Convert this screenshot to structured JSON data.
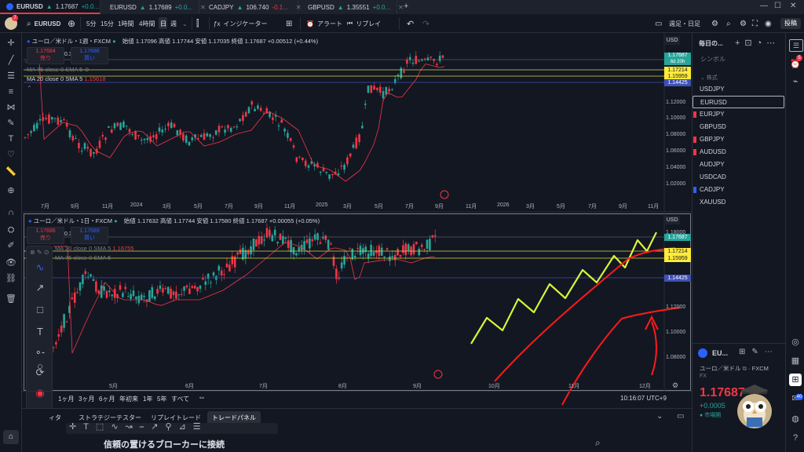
{
  "tabs": [
    {
      "symbol": "EURUSD",
      "arrow": "▲",
      "price": "1.17687",
      "change": "+0.0..."
    },
    {
      "symbol": "EURUSD",
      "arrow": "▲",
      "price": "1.17689",
      "change": "+0.0..."
    },
    {
      "symbol": "CADJPY",
      "arrow": "▲",
      "price": "106.740",
      "change": "-0.1..."
    },
    {
      "symbol": "GBPUSD",
      "arrow": "▲",
      "price": "1.35551",
      "change": "+0.0..."
    }
  ],
  "toolbar": {
    "symbol": "EURUSD",
    "intervals": [
      "5分",
      "15分",
      "1時間",
      "4時間",
      "日",
      "週"
    ],
    "active_interval": "日",
    "indicators": "インジケーター",
    "alert": "アラート",
    "replay": "リプレイ",
    "session": "週足・日足",
    "publish": "投稿"
  },
  "top_chart": {
    "title": "ユーロ／米ドル・1週・FXCM",
    "ohlc": "始値 1.17096  高値 1.17744  安値 1.17035  終値 1.17687 +0.00512 (+0.44%)",
    "sell_price": "1.17684",
    "sell_label": "売り",
    "spread": "0.3",
    "buy_price": "1.17688",
    "buy_label": "買い",
    "ma75": "MA 75 close 0 SMA 5",
    "ma20": "MA 20 close 0 SMA 5",
    "ma20_value": "1.15618",
    "currency": "USD",
    "y_ticks": [
      "1.12000",
      "1.10000",
      "1.08000",
      "1.06000",
      "1.04000",
      "1.02000"
    ],
    "x_ticks": [
      "7月",
      "9月",
      "11月",
      "2024",
      "3月",
      "5月",
      "7月",
      "9月",
      "11月",
      "2025",
      "3月",
      "5月",
      "7月",
      "9月",
      "11月",
      "2026",
      "3月",
      "5月",
      "7月",
      "9月",
      "11月"
    ],
    "price_tags": [
      "1.17687",
      "1.17214",
      "1.15959",
      "1.14425"
    ],
    "countdown": "6d 20h"
  },
  "bottom_chart": {
    "title": "ユーロ／米ドル・1日・FXCM",
    "ohlc": "始値 1.17632  高値 1.17744  安値 1.17580  終値 1.17687 +0.00055 (+0.05%)",
    "sell_price": "1.17686",
    "sell_label": "売り",
    "spread": "0.3",
    "buy_price": "1.17689",
    "buy_label": "買い",
    "ma20_value": "1.16755",
    "ma75": "MA 20 close 0 SMA 5",
    "ma20b": "MA 75 close 0 SMA 5",
    "currency": "USD",
    "y_ticks": [
      "1.18000",
      "1.14000",
      "1.12000",
      "1.10000",
      "1.08000"
    ],
    "x_ticks": [
      "5月",
      "6月",
      "7月",
      "8月",
      "9月",
      "10月",
      "11月",
      "12月"
    ],
    "price_tags": [
      "1.17687",
      "1.17214",
      "1.15959",
      "1.14425"
    ]
  },
  "bottom_bar": {
    "ranges": [
      "1ヶ月",
      "3ヶ月",
      "6ヶ月",
      "年初来",
      "1年",
      "5年",
      "すべて"
    ],
    "time": "10:16:07 UTC+9"
  },
  "panel_tabs": [
    "ストラテジーテスター",
    "リプレイトレード",
    "トレードパネル"
  ],
  "panel_prefix": "ィタ",
  "caption": "信頼の置けるブローカーに接続",
  "watchlist": {
    "title": "毎日の...",
    "column": "シンボル",
    "section": "株式",
    "items": [
      {
        "symbol": "USDJPY",
        "mark": ""
      },
      {
        "symbol": "EURUSD",
        "mark": "",
        "selected": true
      },
      {
        "symbol": "EURJPY",
        "mark": "#f23645"
      },
      {
        "symbol": "GBPUSD",
        "mark": ""
      },
      {
        "symbol": "GBPJPY",
        "mark": "#f23645"
      },
      {
        "symbol": "AUDUSD",
        "mark": "#f23645"
      },
      {
        "symbol": "AUDJPY",
        "mark": ""
      },
      {
        "symbol": "USDCAD",
        "mark": ""
      },
      {
        "symbol": "CADJPY",
        "mark": "#2962ff"
      },
      {
        "symbol": "XAUUSD",
        "mark": ""
      }
    ]
  },
  "detail": {
    "symbol": "EU...",
    "name": "ユーロ／米ドル",
    "exchange": "FXCM",
    "type": "FX",
    "price": "1.17687",
    "change": "+0.0005",
    "status": "市場開"
  },
  "notifications": {
    "badge_top": "5",
    "badge_bottom": "40"
  },
  "colors": {
    "up": "#26a69a",
    "down": "#f23645",
    "ma": "#f23645",
    "yellow_line": "#d4d84a",
    "blue_line": "#3f51b5",
    "drawing_yellow": "#d7f23a",
    "drawing_red": "#ff1a1a"
  }
}
